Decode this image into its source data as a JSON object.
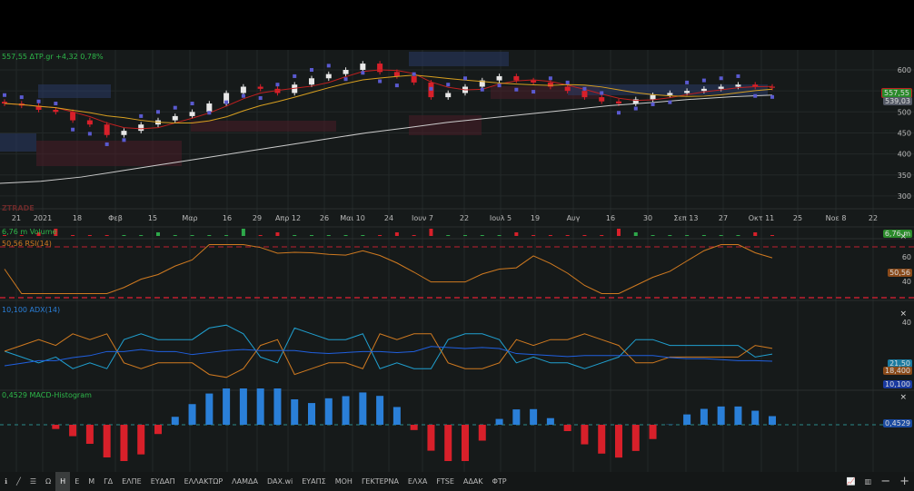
{
  "header": {
    "quote": "557,55 ΔΤΡ.gr +4,32 0,78%",
    "watermark": "ZTRADE"
  },
  "price_axis": {
    "ticks": [
      "600",
      "550",
      "500",
      "450",
      "400",
      "350",
      "300"
    ],
    "last_price": "557,55",
    "ma_price": "539,03"
  },
  "time_axis": [
    "21",
    "2021",
    "18",
    "Φεβ",
    "15",
    "Μαρ",
    "16",
    "29",
    "Απρ 12",
    "26",
    "Μαι 10",
    "24",
    "Ιουν 7",
    "22",
    "Ιουλ 5",
    "19",
    "Αυγ",
    "16",
    "30",
    "Σεπ 13",
    "27",
    "Οκτ 11",
    "25",
    "Νοε 8",
    "22"
  ],
  "volume": {
    "label": "6,76 m Volume",
    "value_tag": "6,76 m"
  },
  "rsi": {
    "label": "50,56 RSI(14)",
    "value_tag": "50,56",
    "ticks": [
      "60",
      "40"
    ]
  },
  "adx": {
    "label": "10,100 ADX(14)",
    "tick": "40",
    "tags": [
      "21,50",
      "18,400",
      "10,100"
    ]
  },
  "macd": {
    "label": "0,4529 MACD-Histogram",
    "value_tag": "0,4529"
  },
  "close_icon": "×",
  "colors": {
    "up": "#2ea84a",
    "down": "#d8202a",
    "rsi": "#d07a20",
    "adx": "#2060e0",
    "di_plus": "#20a0d0",
    "di_minus": "#d07a20",
    "macd_up": "#2a7fd8",
    "macd_down": "#d8202a"
  },
  "chart_data": {
    "type": "candlestick",
    "closes": [
      520,
      515,
      505,
      500,
      480,
      470,
      445,
      455,
      470,
      480,
      490,
      500,
      520,
      545,
      560,
      555,
      545,
      565,
      580,
      590,
      600,
      615,
      595,
      585,
      570,
      535,
      545,
      560,
      575,
      585,
      575,
      570,
      560,
      550,
      535,
      525,
      520,
      530,
      540,
      545,
      550,
      555,
      560,
      565,
      560,
      557.55
    ],
    "ma_long": [
      330,
      335,
      345,
      360,
      375,
      390,
      405,
      420,
      435,
      450,
      462,
      475,
      485,
      495,
      505,
      515,
      522,
      530,
      536,
      540
    ],
    "ylim": [
      250,
      650
    ]
  },
  "toolbar": {
    "items": [
      "Ω",
      "Η",
      "Ε",
      "Μ",
      "ΓΔ",
      "ΕΛΠΕ",
      "ΕΥΔΑΠ",
      "ΕΛΛΑΚΤΩΡ",
      "ΛΑΜΔΑ",
      "DAX.wi",
      "ΕΥΑΠΣ",
      "ΜΟΗ",
      "ΓΕΚΤΕΡΝΑ",
      "ΕΛΧΑ",
      "FTSE",
      "ΑΔΑΚ",
      "ΦΤΡ"
    ],
    "active": "Η"
  }
}
